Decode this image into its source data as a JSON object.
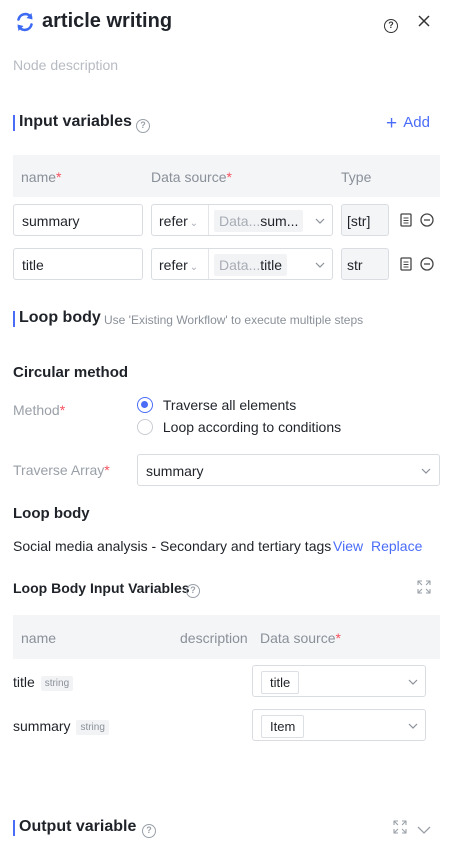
{
  "header": {
    "title": "article writing",
    "description_placeholder": "Node description",
    "help_icon": "help-circle-icon",
    "close_icon": "close-icon"
  },
  "input_variables": {
    "title": "Input variables",
    "add_label": "Add",
    "columns": {
      "name": "name",
      "data_source": "Data source",
      "type": "Type"
    },
    "rows": [
      {
        "name": "summary",
        "mode": "refer",
        "source_prefix": "Data...",
        "source_value": "sum...",
        "type": "[str]"
      },
      {
        "name": "title",
        "mode": "refer",
        "source_prefix": "Data...",
        "source_value": "title",
        "type": "str"
      }
    ]
  },
  "loop_body_section": {
    "title": "Loop body",
    "hint": "Use 'Existing Workflow' to execute multiple steps"
  },
  "circular_method": {
    "title": "Circular method",
    "method_label": "Method",
    "options": [
      "Traverse all elements",
      "Loop according to conditions"
    ],
    "selected_index": 0,
    "traverse_label": "Traverse Array",
    "traverse_value": "summary"
  },
  "loop_body": {
    "title": "Loop body",
    "workflow_name": "Social media analysis - Secondary and tertiary tags",
    "view_label": "View",
    "replace_label": "Replace"
  },
  "loop_inputs": {
    "title": "Loop Body Input Variables",
    "columns": {
      "name": "name",
      "description": "description",
      "data_source": "Data source"
    },
    "rows": [
      {
        "name": "title",
        "type": "string",
        "source": "title"
      },
      {
        "name": "summary",
        "type": "string",
        "source": "Item"
      }
    ]
  },
  "output": {
    "title": "Output variable"
  },
  "colors": {
    "accent": "#4a6cf7",
    "required": "#f5515f",
    "muted": "#a8adb5",
    "header_bg": "#f4f5f7"
  }
}
